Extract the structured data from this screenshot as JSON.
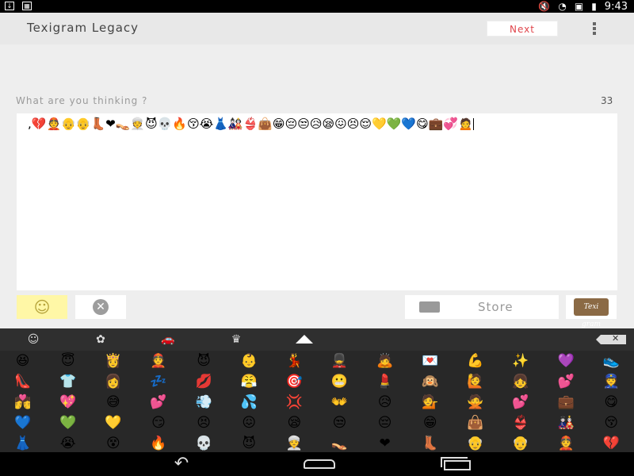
{
  "status_bar": {
    "time": "9:43",
    "notification_icon": "download-icon",
    "grid_icon": "grid-icon"
  },
  "app": {
    "title": "Texigram Legacy",
    "next_label": "Next"
  },
  "compose": {
    "prompt": "What are you thinking ?",
    "char_count": "33",
    "content": ",💔👲👴👴👢❤👡👳😈💀🔥😚😭👗🎎👙👜😁😔😒😥😪😖😣😌💛💚💙😋💼💞🙍"
  },
  "actions": {
    "store_label": "Store",
    "logo_text": "Texi gram"
  },
  "keyboard": {
    "tabs": [
      "☺",
      "✿",
      "🚗",
      "♛"
    ],
    "rows": [
      [
        "😆",
        "😇",
        "👸",
        "👲",
        "😈",
        "👶",
        "💃",
        "💂",
        "🙇",
        "💌",
        "💪",
        "✨",
        "💜",
        "👟"
      ],
      [
        "👠",
        "👕",
        "👩",
        "💤",
        "💋",
        "😤",
        "🎯",
        "😬",
        "💄",
        "🙉",
        "🙋",
        "👧",
        "💕",
        "👮"
      ],
      [
        "💏",
        "💖",
        "😅",
        "💕",
        "💨",
        "💦",
        "💢",
        "👐",
        "😥",
        "💁",
        "🙅",
        "💕",
        "💼",
        "😋"
      ],
      [
        "💙",
        "💚",
        "💛",
        "😏",
        "😣",
        "😖",
        "😪",
        "😒",
        "😔",
        "😁",
        "👜",
        "👙",
        "🎎",
        "😚"
      ],
      [
        "👗",
        "😭",
        "😵",
        "🔥",
        "💀",
        "😈",
        "👳",
        "👡",
        "❤",
        "👢",
        "👴",
        "👴",
        "👲",
        "💔"
      ]
    ]
  }
}
